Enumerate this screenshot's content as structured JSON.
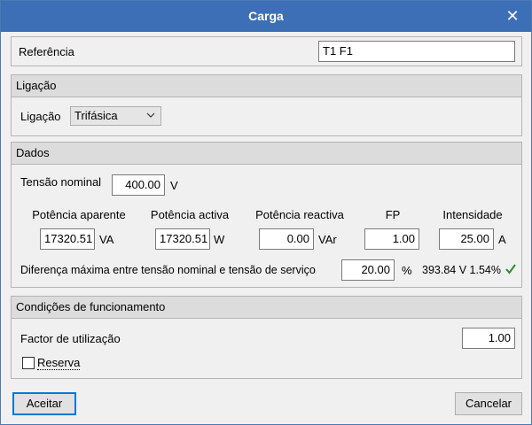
{
  "window": {
    "title": "Carga"
  },
  "referencia": {
    "label": "Referência",
    "value": "T1 F1"
  },
  "ligacao": {
    "section": "Ligação",
    "label": "Ligação",
    "selected": "Trifásica"
  },
  "dados": {
    "section": "Dados",
    "tensao_label": "Tensão nominal",
    "tensao_value": "400.00",
    "tensao_unit": "V",
    "columns": {
      "potencia_aparente": {
        "header": "Potência aparente",
        "value": "17320.51",
        "unit": "VA"
      },
      "potencia_activa": {
        "header": "Potência activa",
        "value": "17320.51",
        "unit": "W"
      },
      "potencia_reactiva": {
        "header": "Potência reactiva",
        "value": "0.00",
        "unit": "VAr"
      },
      "fp": {
        "header": "FP",
        "value": "1.00"
      },
      "intensidade": {
        "header": "Intensidade",
        "value": "25.00",
        "unit": "A"
      }
    },
    "diferenca_label": "Diferença máxima entre tensão nominal e tensão de serviço",
    "diferenca_value": "20.00",
    "diferenca_unit": "%",
    "diferenca_result": "393.84 V 1.54%",
    "check_color": "#2e8b2e"
  },
  "condicoes": {
    "section": "Condições de funcionamento",
    "factor_label": "Factor de utilização",
    "factor_value": "1.00",
    "reserva_label": "Reserva",
    "reserva_checked": false
  },
  "buttons": {
    "accept": "Aceitar",
    "cancel": "Cancelar"
  },
  "colors": {
    "titlebar": "#3d6fb6",
    "header": "#dcdcdc",
    "accent": "#0078d7"
  }
}
